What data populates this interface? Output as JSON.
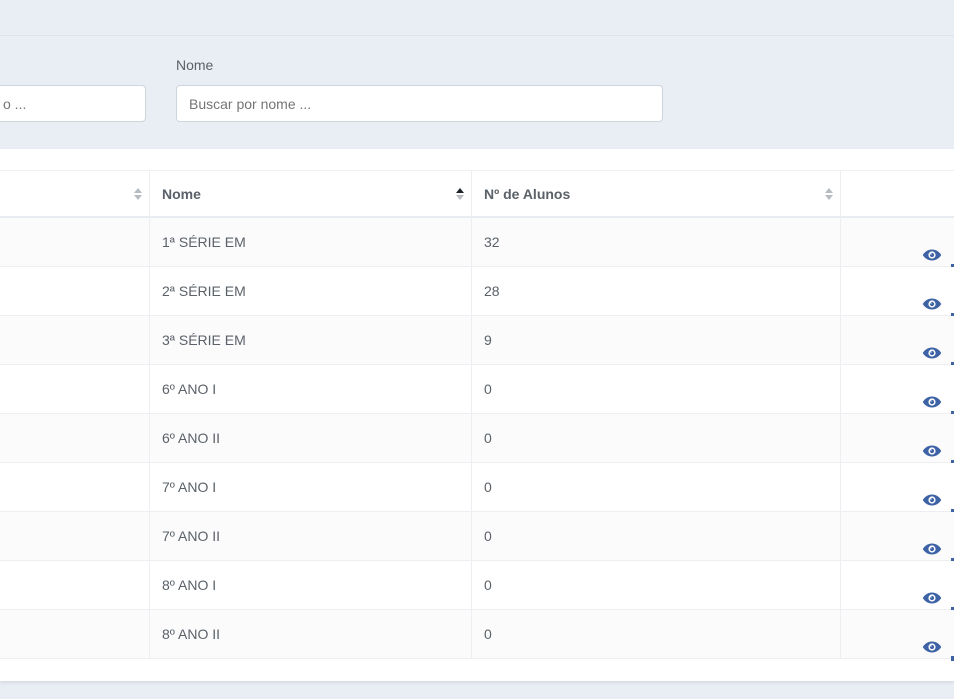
{
  "filters": {
    "name_label": "Nome",
    "left_placeholder": "o ...",
    "name_placeholder": "Buscar por nome ..."
  },
  "table": {
    "columns": [
      {
        "label": "",
        "sort": "none"
      },
      {
        "label": "Nome",
        "sort": "ascending"
      },
      {
        "label": "Nº de Alunos",
        "sort": "none"
      },
      {
        "label": "",
        "sort": "none"
      }
    ],
    "rows": [
      {
        "nome": "1ª SÉRIE EM",
        "alunos": "32"
      },
      {
        "nome": "2ª SÉRIE EM",
        "alunos": "28"
      },
      {
        "nome": "3ª SÉRIE EM",
        "alunos": "9"
      },
      {
        "nome": "6º ANO I",
        "alunos": "0"
      },
      {
        "nome": "6º ANO II",
        "alunos": "0"
      },
      {
        "nome": "7º ANO I",
        "alunos": "0"
      },
      {
        "nome": "7º ANO II",
        "alunos": "0"
      },
      {
        "nome": "8º ANO I",
        "alunos": "0"
      },
      {
        "nome": "8º ANO II",
        "alunos": "0"
      }
    ],
    "row_action_icon": "eye-icon"
  },
  "colors": {
    "page_bg": "#e9edf4",
    "accent": "#3e63a5",
    "text": "#5b6168"
  }
}
